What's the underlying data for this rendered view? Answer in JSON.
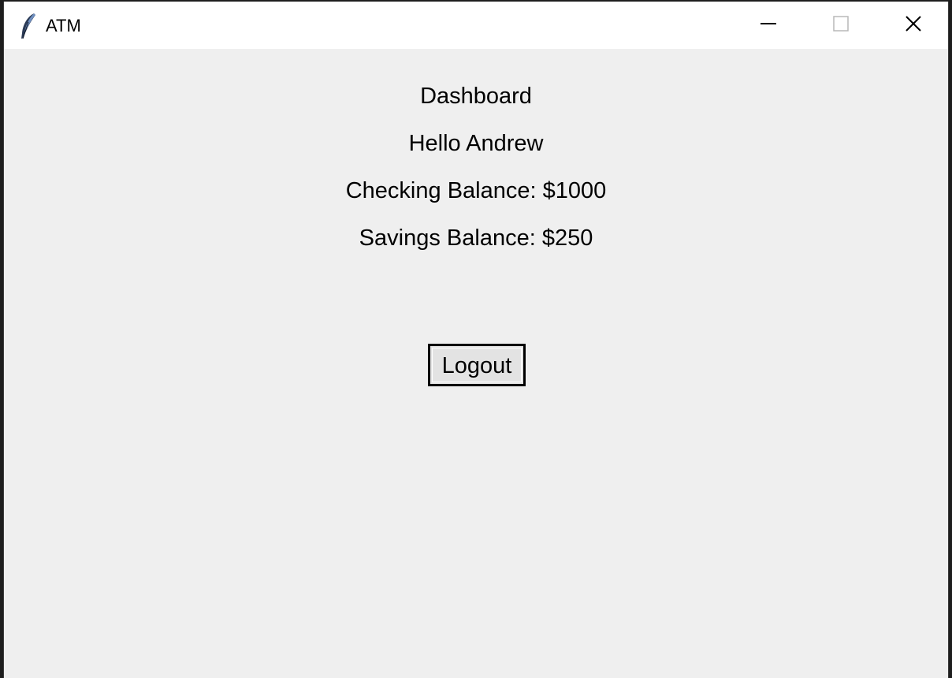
{
  "window": {
    "title": "ATM",
    "app_icon": "feather-icon",
    "controls": {
      "minimize_icon": "minimize-icon",
      "maximize_icon": "maximize-icon",
      "close_icon": "close-icon"
    }
  },
  "dashboard": {
    "heading": "Dashboard",
    "greeting": "Hello Andrew",
    "checking_balance": "Checking Balance: $1000",
    "savings_balance": "Savings Balance: $250",
    "logout_label": "Logout"
  },
  "colors": {
    "window_background": "#efefef",
    "titlebar_background": "#ffffff",
    "button_background": "#e3e3e3",
    "button_border": "#000000"
  }
}
